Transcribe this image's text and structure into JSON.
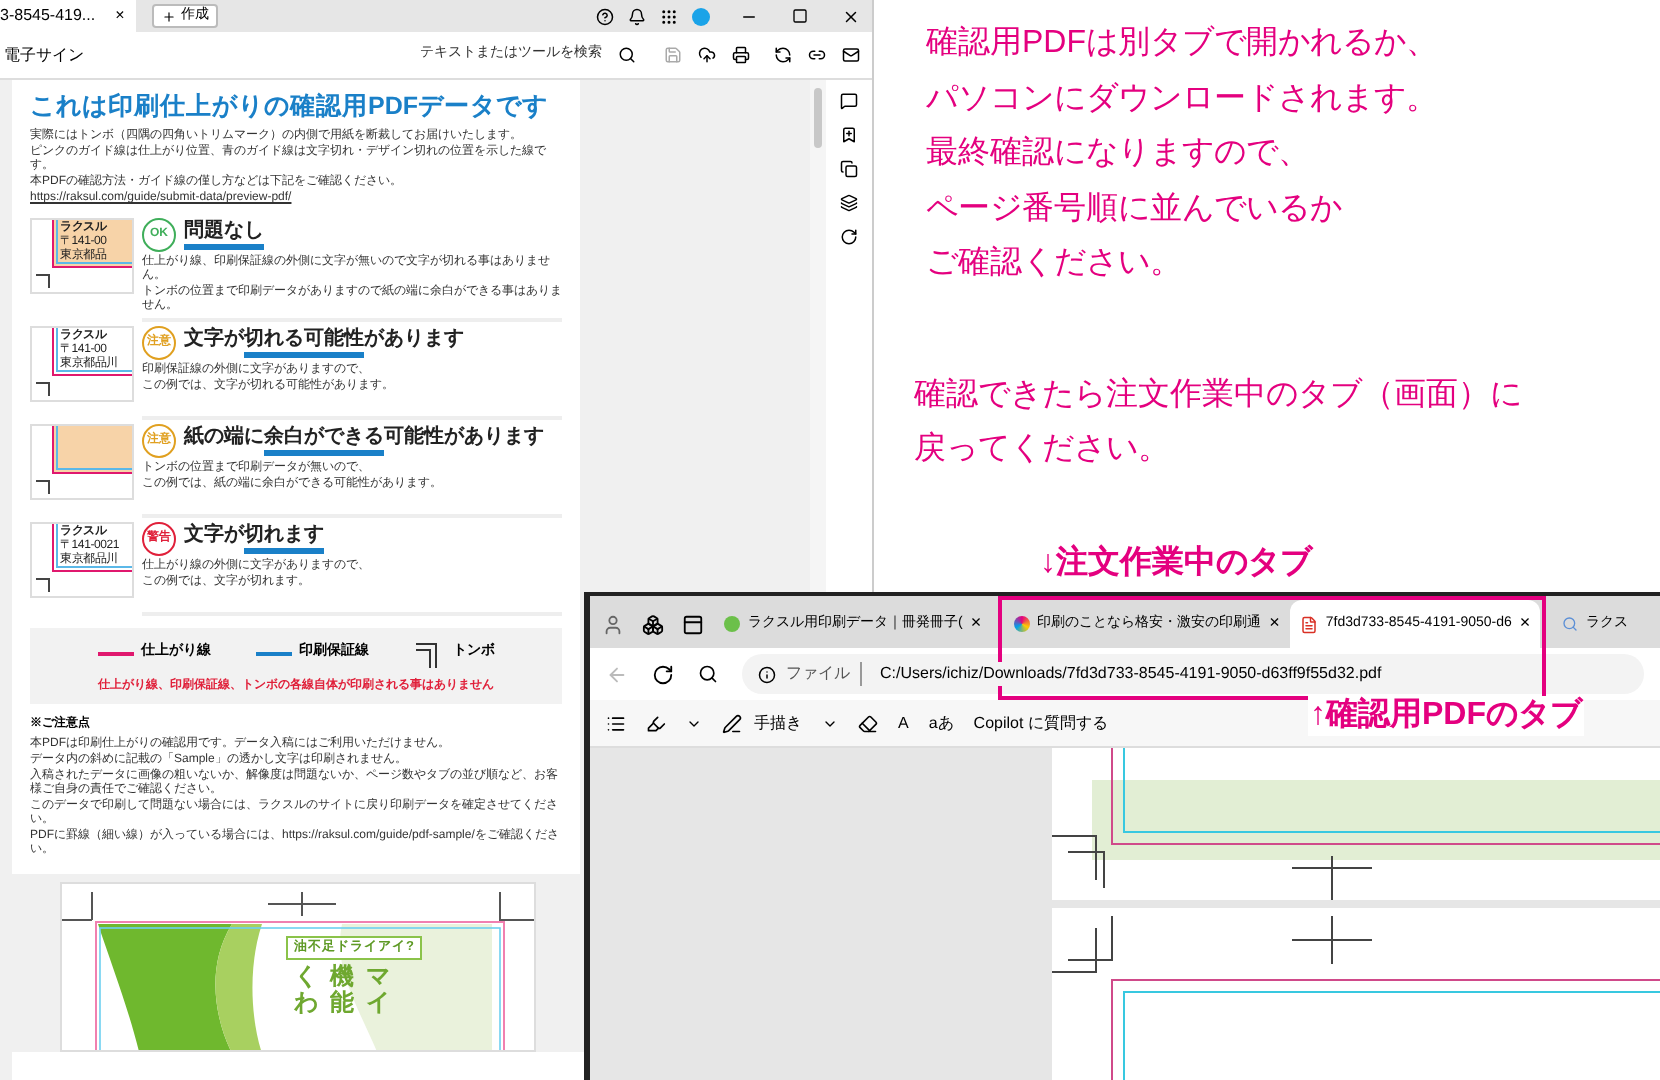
{
  "viewer": {
    "tab": {
      "title": "3-8545-419...",
      "close": "×"
    },
    "new_tab": "作成",
    "toolbar": {
      "left_label": "電子サイン",
      "search_placeholder": "テキストまたはツールを検索"
    },
    "page": {
      "title": "これは印刷仕上がりの確認用PDFデータです",
      "intro": [
        "実際にはトンボ（四隅の四角いトリムマーク）の内側で用紙を断裁してお届けいたします。",
        "ピンクのガイド線は仕上がり位置、青のガイド線は文字切れ・デザイン切れの位置を示した線です。",
        "本PDFの確認方法・ガイド線の僅し方などは下記をご確認ください。"
      ],
      "link": "https://raksul.com/guide/submit-data/preview-pdf/",
      "cases": [
        {
          "badge": "OK",
          "color": "#3fae5a",
          "thumb_fill": true,
          "thumb_lines": [
            "ラクスル",
            "〒141-00",
            "東京都品"
          ],
          "heading": [
            {
              "text": "問題なし",
              "marked": true
            }
          ],
          "desc": [
            "仕上がり線、印刷保証線の外側に文字が無いので文字が切れる事はありません。",
            "トンボの位置まで印刷データがありますので紙の端に余白ができる事はありません。"
          ]
        },
        {
          "badge": "注意",
          "color": "#e0a020",
          "thumb_fill": false,
          "thumb_lines": [
            "ラクスル",
            "〒141-00",
            "東京都品川"
          ],
          "heading": [
            {
              "text": "文字が",
              "marked": false
            },
            {
              "text": "切れる可能性",
              "marked": true
            },
            {
              "text": "があります",
              "marked": false
            }
          ],
          "desc": [
            "印刷保証線の外側に文字がありますので、",
            "この例では、文字が切れる可能性があります。"
          ]
        },
        {
          "badge": "注意",
          "color": "#e0a020",
          "thumb_fill": true,
          "heading": [
            {
              "text": "紙の端に",
              "marked": false
            },
            {
              "text": "余白ができる",
              "marked": true
            },
            {
              "text": "可能性があります",
              "marked": false
            }
          ],
          "desc": [
            "トンボの位置まで印刷データが無いので、",
            "この例では、紙の端に余白ができる可能性があります。"
          ]
        },
        {
          "badge": "警告",
          "color": "#e0203a",
          "thumb_fill": false,
          "thumb_lines": [
            "ラクスル",
            "〒141-0021",
            "東京都品川"
          ],
          "heading": [
            {
              "text": "文字が",
              "marked": false
            },
            {
              "text": "切れます",
              "marked": true
            }
          ],
          "desc": [
            "仕上がり線の外側に文字がありますので、",
            "この例では、文字が切れます。"
          ]
        }
      ],
      "legend": [
        {
          "kind": "line",
          "color": "#e0186e",
          "label": "仕上がり線"
        },
        {
          "kind": "line",
          "color": "#1a80c8",
          "label": "印刷保証線"
        },
        {
          "kind": "trim",
          "label": "トンボ"
        }
      ],
      "legend_note": "仕上がり線、印刷保証線、トンボの各線自体が印刷される事はありません",
      "notes_title": "※ご注意点",
      "notes": [
        "本PDFは印刷仕上がりの確認用です。データ入稿にはご利用いただけません。",
        "データ内の斜めに記載の「Sample」の透かし文字は印刷されません。",
        "入稿されたデータに画像の粗いないか、解像度は問題ないか、ページ数やタブの並び順など、お客様ご自身の責任でご確認ください。",
        "このデータで印刷して問題ない場合には、ラクスルのサイトに戻り印刷データを確定させてください。",
        "PDFに罫線（細い線）が入っている場合には、https://raksul.com/guide/pdf-sample/をご確認ください。"
      ]
    },
    "page2": {
      "tag": "油不足ドライアイ?",
      "columns": [
        "くわ",
        "機能",
        "マイ"
      ]
    }
  },
  "annotation": {
    "paragraphs": [
      [
        "確認用PDFは別タブで開かれるか、",
        "パソコンにダウンロードされます。",
        "最終確認になりますので、",
        "ページ番号順に並んでいるか",
        "ご確認ください。"
      ],
      [
        "確認できたら注文作業中のタブ（画面）に",
        "戻ってください。"
      ]
    ],
    "callout_top": "↓注文作業中のタブ",
    "callout_bottom": "↑確認用PDFのタブ"
  },
  "browser": {
    "tabs": [
      {
        "title": "ラクスル用印刷データ｜冊発冊子(",
        "kind": "site",
        "selected": false
      },
      {
        "title": "印刷のことなら格安・激安の印刷通",
        "kind": "site2",
        "selected": false
      },
      {
        "title": "7fd3d733-8545-4191-9050-d6",
        "kind": "pdf",
        "selected": true
      },
      {
        "title": "ラクス",
        "kind": "search",
        "selected": false
      }
    ],
    "close": "×",
    "address_label": "ファイル",
    "address": "C:/Users/ichiz/Downloads/7fd3d733-8545-4191-9050-d63ff9f55d32.pdf",
    "draw_label": "手描き",
    "read_label": "A",
    "translate_label": "aあ",
    "copilot": "Copilot に質問する"
  }
}
